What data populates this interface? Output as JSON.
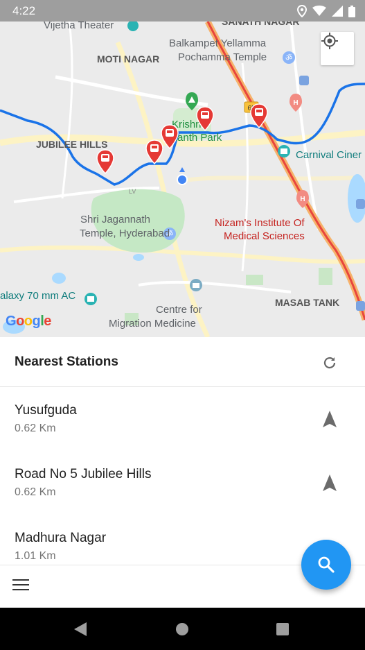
{
  "status_bar": {
    "time": "4:22"
  },
  "map": {
    "labels": {
      "vijetha": "Vijetha Theater",
      "sanath": "SANATH NAGAR",
      "balkampet": "Balkampet Yellamma",
      "pochamma": "Pochamma Temple",
      "moti": "MOTI NAGAR",
      "krishna1": "Krishna",
      "krishna2": "Kanth Park",
      "jubilee": "JUBILEE HILLS",
      "carnival": "Carnival Ciner",
      "jagannath1": "Shri Jagannath",
      "jagannath2": "Temple, Hyderabad",
      "nizam1": "Nizam's Institute Of",
      "nizam2": "Medical Sciences",
      "galaxy": "alaxy 70 mm AC",
      "masab": "MASAB TANK",
      "centre1": "Centre for",
      "centre2": "Migration Medicine",
      "route_badge": "65"
    },
    "google_logo": [
      "G",
      "o",
      "o",
      "g",
      "l",
      "e"
    ],
    "colors": {
      "water": "#aadaff",
      "park": "#c5e8c5",
      "route": "#1a73e8",
      "highway": "#e8453c",
      "marker": "#e53935"
    }
  },
  "panel": {
    "title": "Nearest Stations",
    "stations": [
      {
        "name": "Yusufguda",
        "distance": "0.62 Km"
      },
      {
        "name": "Road No 5 Jubilee Hills",
        "distance": "0.62 Km"
      },
      {
        "name": "Madhura Nagar",
        "distance": "1.01 Km"
      }
    ]
  },
  "icons": {
    "locate": "my-location-icon",
    "refresh": "refresh-icon",
    "navigate": "navigation-arrow-icon",
    "menu": "hamburger-menu-icon",
    "search": "search-icon"
  },
  "accent_color": "#2196f3"
}
